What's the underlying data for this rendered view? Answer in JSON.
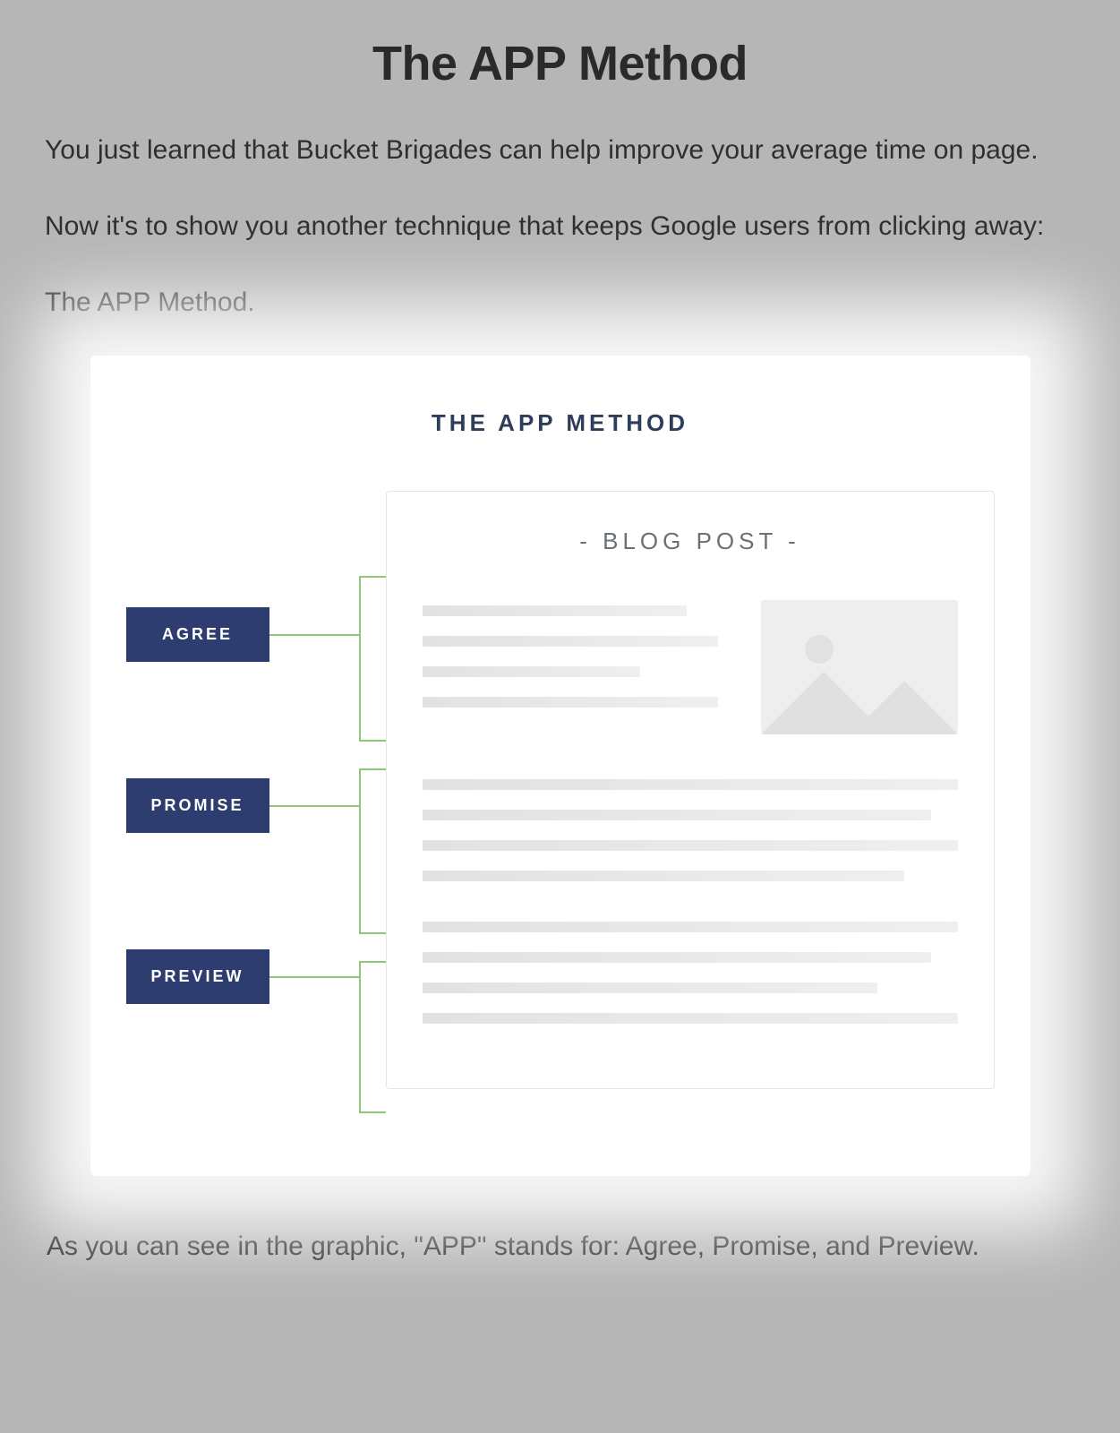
{
  "heading": "The APP Method",
  "intro_p1": "You just learned that Bucket Brigades can help improve your average time on page.",
  "intro_p2": "Now it's to show you another technique that keeps Google users from clicking away:",
  "intro_p3": "The APP Method.",
  "graphic": {
    "title": "THE APP METHOD",
    "blog_label": "- BLOG POST -",
    "labels": {
      "agree": "AGREE",
      "promise": "PROMISE",
      "preview": "PREVIEW"
    }
  },
  "closing": "As you can see in the graphic, \"APP\" stands for: Agree, Promise, and Preview."
}
